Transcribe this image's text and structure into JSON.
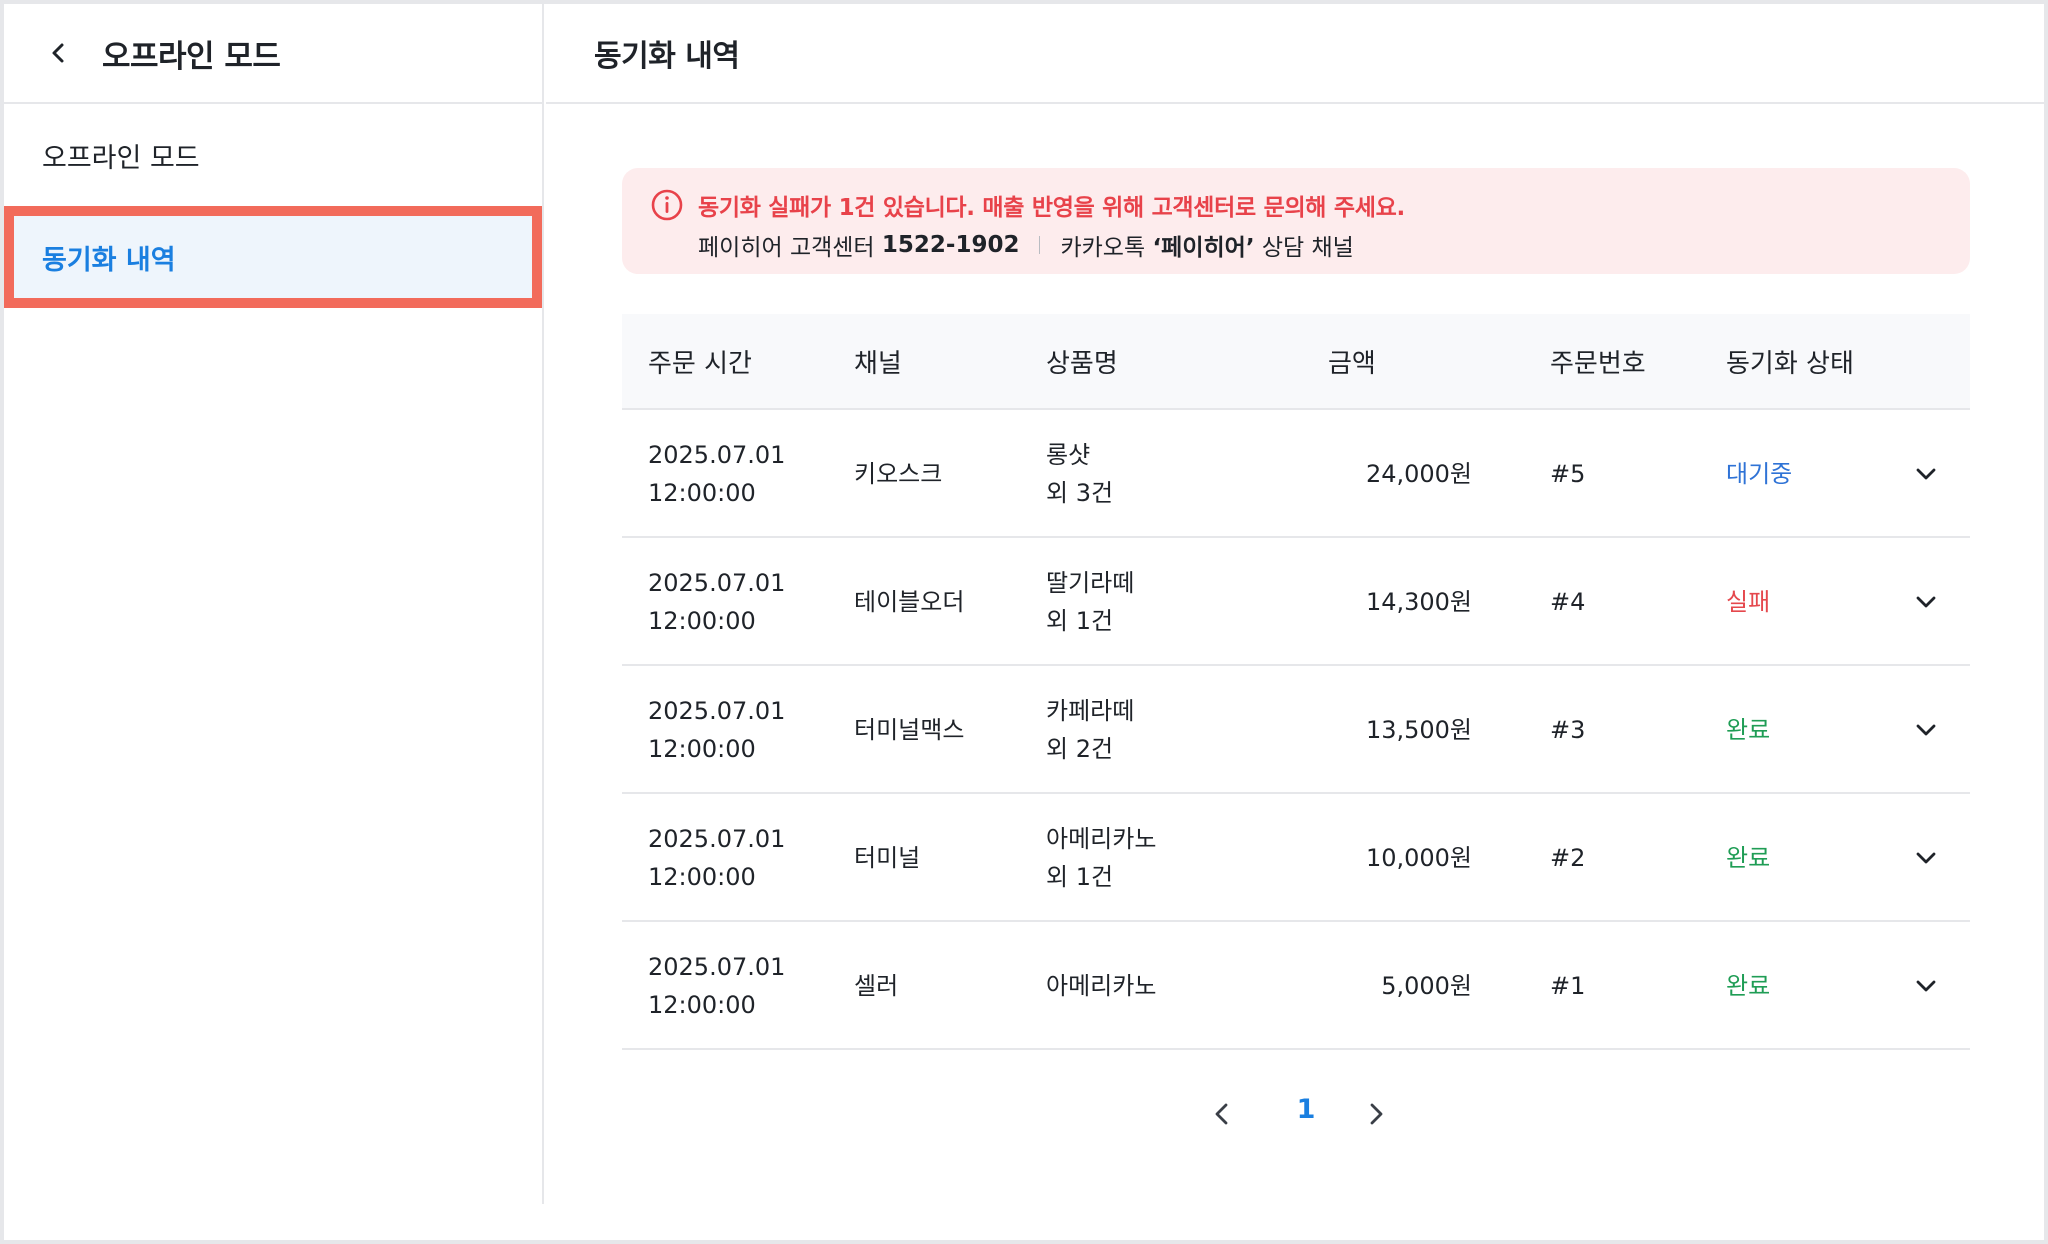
{
  "sidebar": {
    "title": "오프라인 모드",
    "items": [
      {
        "label": "오프라인 모드",
        "active": false
      },
      {
        "label": "동기화 내역",
        "active": true
      }
    ]
  },
  "main": {
    "title": "동기화 내역",
    "alert": {
      "message": "동기화 실패가 1건 있습니다. 매출 반영을 위해 고객센터로 문의해 주세요.",
      "center_label": "페이히어 고객센터",
      "center_phone": "1522-1902",
      "kakao_prefix": "카카오톡",
      "kakao_channel": "‘페이히어’",
      "kakao_suffix": "상담 채널"
    },
    "table": {
      "headers": [
        "주문 시간",
        "채널",
        "상품명",
        "금액",
        "주문번호",
        "동기화 상태"
      ],
      "rows": [
        {
          "date": "2025.07.01",
          "time": "12:00:00",
          "channel": "키오스크",
          "product": "롱샷",
          "product_extra": "외 3건",
          "amount": "24,000원",
          "order": "#5",
          "status": "대기중",
          "status_type": "waiting"
        },
        {
          "date": "2025.07.01",
          "time": "12:00:00",
          "channel": "테이블오더",
          "product": "딸기라떼",
          "product_extra": "외 1건",
          "amount": "14,300원",
          "order": "#4",
          "status": "실패",
          "status_type": "failed"
        },
        {
          "date": "2025.07.01",
          "time": "12:00:00",
          "channel": "터미널맥스",
          "product": "카페라떼",
          "product_extra": "외 2건",
          "amount": "13,500원",
          "order": "#3",
          "status": "완료",
          "status_type": "done"
        },
        {
          "date": "2025.07.01",
          "time": "12:00:00",
          "channel": "터미널",
          "product": "아메리카노",
          "product_extra": "외 1건",
          "amount": "10,000원",
          "order": "#2",
          "status": "완료",
          "status_type": "done"
        },
        {
          "date": "2025.07.01",
          "time": "12:00:00",
          "channel": "셀러",
          "product": "아메리카노",
          "product_extra": "",
          "amount": "5,000원",
          "order": "#1",
          "status": "완료",
          "status_type": "done"
        }
      ]
    },
    "pagination": {
      "current": "1"
    }
  },
  "colors": {
    "accent": "#1a7fe0",
    "failed": "#e5484d",
    "done": "#1f9d55",
    "waiting": "#2f73d6",
    "highlight": "#f26b5b"
  }
}
